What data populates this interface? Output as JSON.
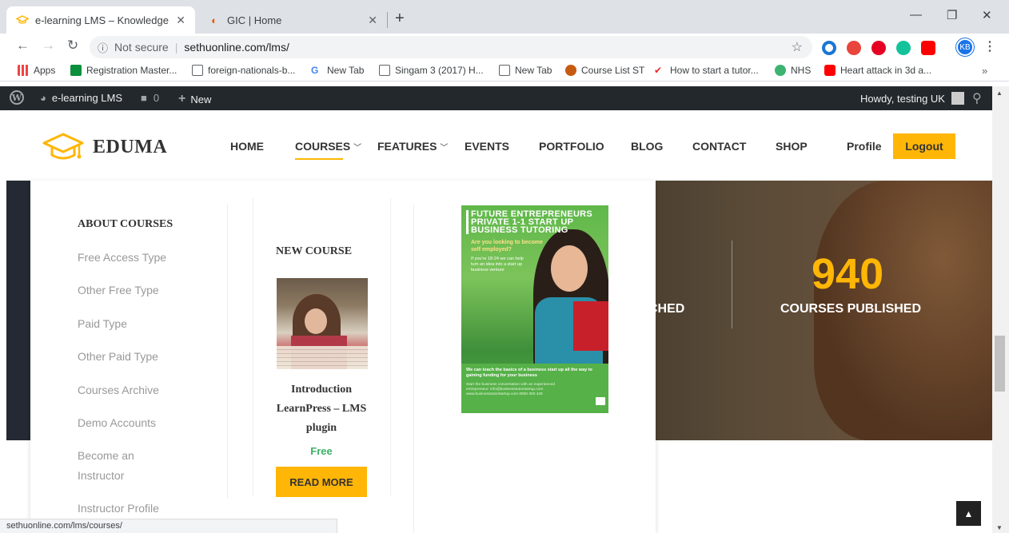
{
  "browser": {
    "tabs": [
      {
        "title": "e-learning LMS – Knowledge Frui",
        "active": true
      },
      {
        "title": "GIC | Home",
        "active": false
      }
    ],
    "address": {
      "security": "Not secure",
      "url": "sethuonline.com/lms/"
    },
    "profile_initials": "KB",
    "bookmarks": [
      {
        "label": "Apps",
        "icon": "apps-grid-icon",
        "color": "#e44"
      },
      {
        "label": "Registration Master...",
        "icon": "plus-square-icon",
        "color": "#0a8f3c"
      },
      {
        "label": "foreign-nationals-b...",
        "icon": "page-icon",
        "color": "#fff"
      },
      {
        "label": "New Tab",
        "icon": "google-g-icon",
        "color": "#4285f4"
      },
      {
        "label": "Singam 3 (2017) H...",
        "icon": "page-icon",
        "color": "#fff"
      },
      {
        "label": "New Tab",
        "icon": "page-icon",
        "color": "#fff"
      },
      {
        "label": "Course List ST",
        "icon": "circle-icon",
        "color": "#c55a11"
      },
      {
        "label": "How to start a tutor...",
        "icon": "swoosh-icon",
        "color": "#e22"
      },
      {
        "label": "NHS",
        "icon": "shield-icon",
        "color": "#3cb371"
      },
      {
        "label": "Heart attack in 3d a...",
        "icon": "youtube-icon",
        "color": "#f00"
      }
    ],
    "more_bookmarks": "»",
    "status_url": "sethuonline.com/lms/courses/"
  },
  "adminbar": {
    "site_name": "e-learning LMS",
    "comments_count": "0",
    "new_label": "New",
    "greeting": "Howdy, testing UK"
  },
  "header": {
    "logo_text": "EDUMA",
    "nav": [
      "HOME",
      "COURSES",
      "FEATURES",
      "EVENTS",
      "PORTFOLIO",
      "BLOG",
      "CONTACT",
      "SHOP"
    ],
    "profile_label": "Profile",
    "logout_label": "Logout",
    "accent_color": "#ffb606"
  },
  "hero": {
    "stat_left_label_fragment": "CHED",
    "stat_number": "940",
    "stat_label": "COURSES PUBLISHED"
  },
  "mega": {
    "about_title": "ABOUT COURSES",
    "about_links": [
      "Free Access Type",
      "Other Free Type",
      "Paid Type",
      "Other Paid Type",
      "Courses Archive",
      "Demo Accounts",
      "Become an Instructor",
      "Instructor Profile"
    ],
    "new_course_title": "NEW COURSE",
    "course_name": "Introduction LearnPress – LMS plugin",
    "course_price": "Free",
    "read_more": "READ MORE",
    "price_color": "#3db166",
    "promo": {
      "heading": "FUTURE ENTREPRENEURS PRIVATE 1-1 START UP BUSINESS TUTORING",
      "question": "Are you looking to become self employed?",
      "para": "If you're 18-24 we can help turn an idea into a start up business venture",
      "footer_main": "We can teach the basics of a business start up all the way to gaining funding for your business",
      "footer_small": "Start the business conversation with an experienced entrepreneur: info@businesstutorstartup.com www.businesstutorstartup.com 0800 300 428"
    }
  }
}
